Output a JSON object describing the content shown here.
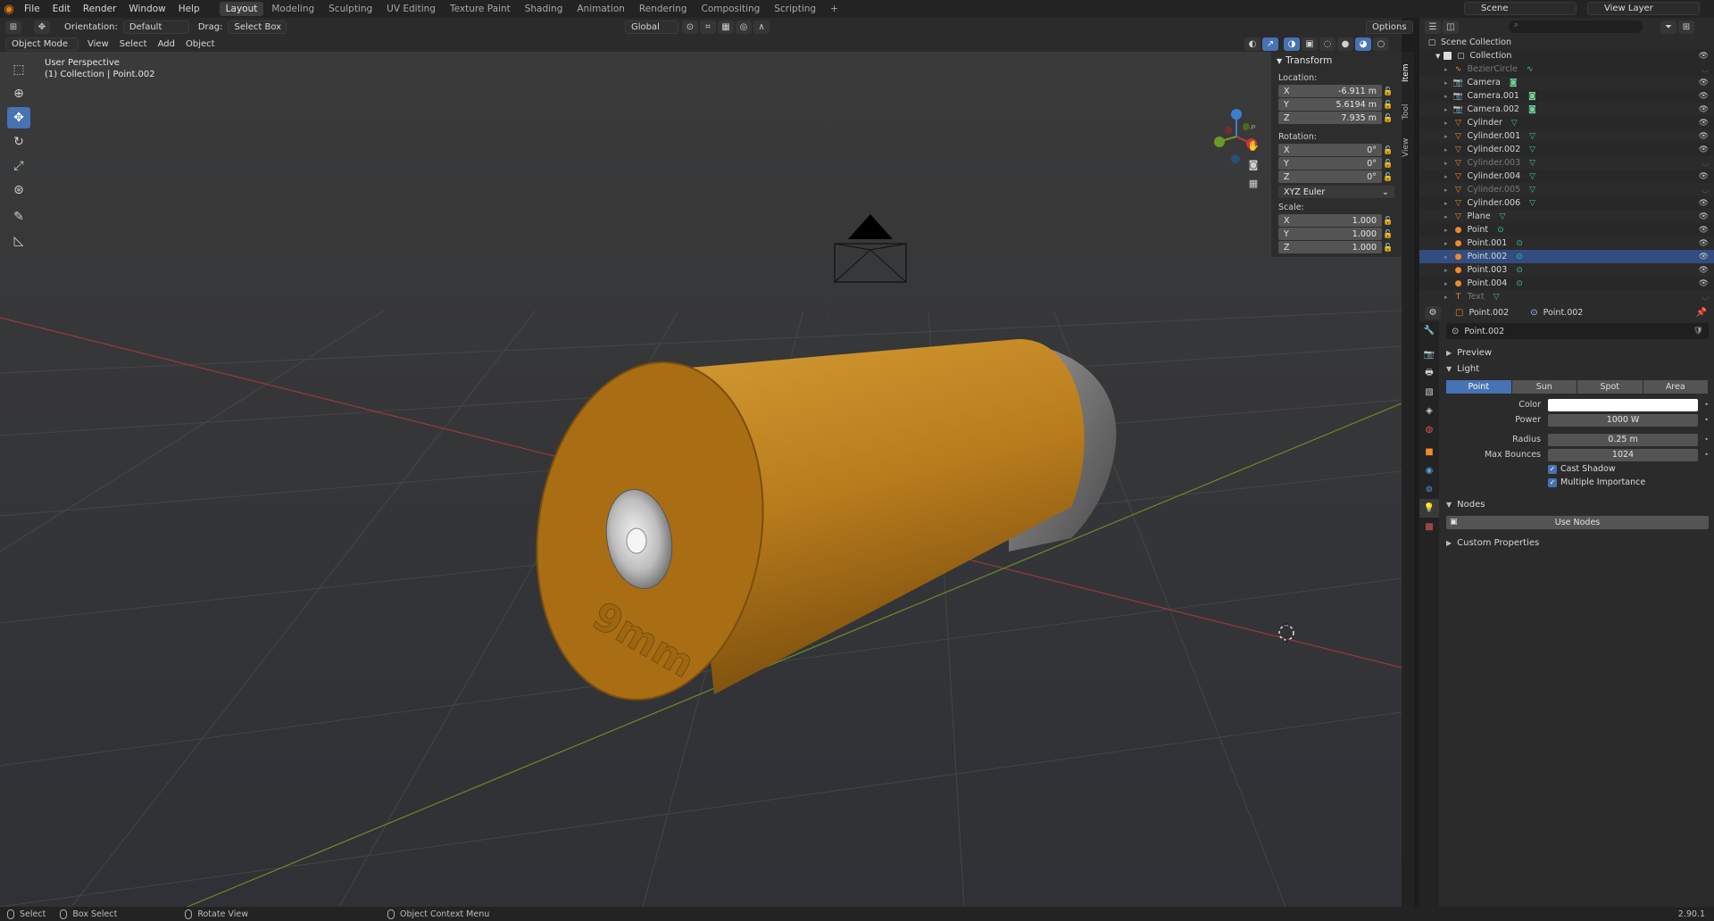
{
  "app": {
    "menu": [
      "File",
      "Edit",
      "Render",
      "Window",
      "Help"
    ],
    "workspaces": [
      "Layout",
      "Modeling",
      "Sculpting",
      "UV Editing",
      "Texture Paint",
      "Shading",
      "Animation",
      "Rendering",
      "Compositing",
      "Scripting"
    ],
    "active_workspace": "Layout",
    "add_workspace": "+",
    "scene": "Scene",
    "view_layer": "View Layer"
  },
  "viewport_header": {
    "orientation_label": "Orientation:",
    "orientation_value": "Default",
    "drag_label": "Drag:",
    "drag_value": "Select Box",
    "transform_space": "Global",
    "options": "Options",
    "mode": "Object Mode",
    "menus": [
      "View",
      "Select",
      "Add",
      "Object"
    ]
  },
  "viewport": {
    "perspective": "User Perspective",
    "context": "(1) Collection | Point.002",
    "engraving": "9mm",
    "colors": {
      "background": "#393939",
      "case": "#b97c1d",
      "bullet": "#7e7e7e",
      "primer": "#cfcfcf"
    }
  },
  "n_panel": {
    "title": "Transform",
    "location_label": "Location:",
    "location": [
      {
        "axis": "X",
        "value": "-6.911 m"
      },
      {
        "axis": "Y",
        "value": "5.6194 m"
      },
      {
        "axis": "Z",
        "value": "7.935 m"
      }
    ],
    "rotation_label": "Rotation:",
    "rotation": [
      {
        "axis": "X",
        "value": "0°"
      },
      {
        "axis": "Y",
        "value": "0°"
      },
      {
        "axis": "Z",
        "value": "0°"
      }
    ],
    "rotation_mode": "XYZ Euler",
    "scale_label": "Scale:",
    "scale": [
      {
        "axis": "X",
        "value": "1.000"
      },
      {
        "axis": "Y",
        "value": "1.000"
      },
      {
        "axis": "Z",
        "value": "1.000"
      }
    ],
    "side_tabs": [
      "Item",
      "Tool",
      "View"
    ]
  },
  "outliner": {
    "root": "Scene Collection",
    "collection": "Collection",
    "items": [
      {
        "name": "BezierCircle",
        "icon": "curve-icon",
        "dim": true,
        "hidden": true
      },
      {
        "name": "Camera",
        "icon": "camera-icon",
        "dim": false,
        "hidden": false
      },
      {
        "name": "Camera.001",
        "icon": "camera-icon",
        "dim": false,
        "hidden": false
      },
      {
        "name": "Camera.002",
        "icon": "camera-icon",
        "dim": false,
        "hidden": false
      },
      {
        "name": "Cylinder",
        "icon": "mesh-icon",
        "dim": false,
        "hidden": false
      },
      {
        "name": "Cylinder.001",
        "icon": "mesh-icon",
        "dim": false,
        "hidden": false
      },
      {
        "name": "Cylinder.002",
        "icon": "mesh-icon",
        "dim": false,
        "hidden": false
      },
      {
        "name": "Cylinder.003",
        "icon": "mesh-icon",
        "dim": true,
        "hidden": true
      },
      {
        "name": "Cylinder.004",
        "icon": "mesh-icon",
        "dim": false,
        "hidden": false
      },
      {
        "name": "Cylinder.005",
        "icon": "mesh-icon",
        "dim": true,
        "hidden": true
      },
      {
        "name": "Cylinder.006",
        "icon": "mesh-icon",
        "dim": false,
        "hidden": false
      },
      {
        "name": "Plane",
        "icon": "mesh-icon",
        "dim": false,
        "hidden": false
      },
      {
        "name": "Point",
        "icon": "light-icon",
        "dim": false,
        "hidden": false
      },
      {
        "name": "Point.001",
        "icon": "light-icon",
        "dim": false,
        "hidden": false
      },
      {
        "name": "Point.002",
        "icon": "light-icon",
        "dim": false,
        "hidden": false,
        "selected": true
      },
      {
        "name": "Point.003",
        "icon": "light-icon",
        "dim": false,
        "hidden": false
      },
      {
        "name": "Point.004",
        "icon": "light-icon",
        "dim": false,
        "hidden": false
      },
      {
        "name": "Text",
        "icon": "text-icon",
        "dim": true,
        "hidden": true
      }
    ]
  },
  "properties": {
    "object": "Point.002",
    "data": "Point.002",
    "datablock": "Point.002",
    "preview": "Preview",
    "light": "Light",
    "light_types": [
      "Point",
      "Sun",
      "Spot",
      "Area"
    ],
    "active_type": "Point",
    "color_label": "Color",
    "color_value": "#ffffff",
    "power_label": "Power",
    "power_value": "1000 W",
    "radius_label": "Radius",
    "radius_value": "0.25 m",
    "bounces_label": "Max Bounces",
    "bounces_value": "1024",
    "cast_shadow": "Cast Shadow",
    "multiple_importance": "Multiple Importance",
    "nodes": "Nodes",
    "use_nodes": "Use Nodes",
    "custom_properties": "Custom Properties"
  },
  "statusbar": {
    "select": "Select",
    "box_select": "Box Select",
    "rotate_view": "Rotate View",
    "context_menu": "Object Context Menu",
    "version": "2.90.1"
  }
}
